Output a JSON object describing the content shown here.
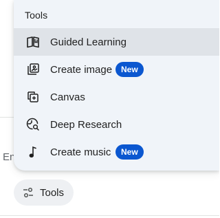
{
  "composer": {
    "placeholder_partial": "En"
  },
  "tools_button": {
    "label": "Tools",
    "icon": "tune-icon"
  },
  "tools_menu": {
    "header": "Tools",
    "items": [
      {
        "label": "Guided Learning",
        "icon": "book-icon",
        "badge": "",
        "highlighted": true
      },
      {
        "label": "Create image",
        "icon": "image-stack-icon",
        "badge": "New",
        "highlighted": false
      },
      {
        "label": "Canvas",
        "icon": "canvas-icon",
        "badge": "",
        "highlighted": false
      },
      {
        "label": "Deep Research",
        "icon": "globe-search-icon",
        "badge": "",
        "highlighted": false
      },
      {
        "label": "Create music",
        "icon": "music-note-icon",
        "badge": "New",
        "highlighted": false
      }
    ]
  },
  "colors": {
    "menu_background": "#f0f4f9",
    "highlight": "#dfe3e8",
    "badge_background": "#0b57d0",
    "badge_text": "#ffffff",
    "text": "#1f1f1f",
    "chip_background": "#eef0f3"
  }
}
